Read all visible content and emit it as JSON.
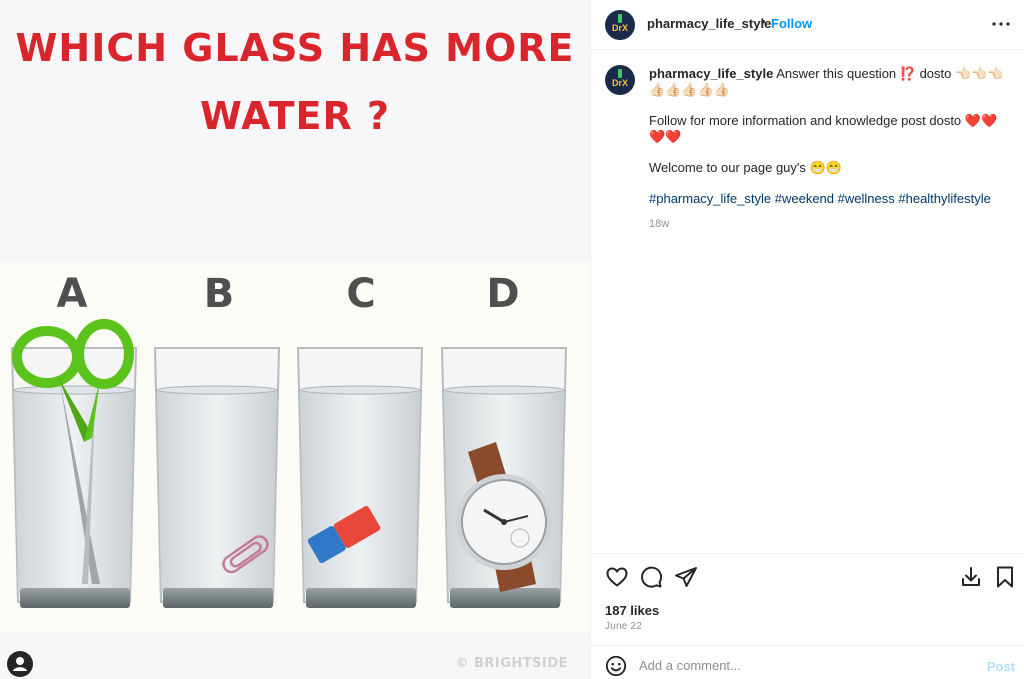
{
  "post_image": {
    "headline_line1": "WHICH GLASS HAS MORE",
    "headline_line2": "WATER ?",
    "glass_labels": [
      "A",
      "B",
      "C",
      "D"
    ],
    "watermark": "© BRIGHTSIDE",
    "colors": {
      "headline": "#d8262c",
      "label": "#4f4f4f",
      "scissors": "#5cc21c",
      "eraser_blue": "#2f79c8",
      "eraser_red": "#e8483c"
    }
  },
  "header": {
    "username": "pharmacy_life_style",
    "separator": "•",
    "follow_label": "Follow",
    "more_icon": "more-horizontal-icon",
    "avatar_monogram": "DrX"
  },
  "caption": {
    "username": "pharmacy_life_style",
    "line1": "Answer this question ⁉️ dosto 👈🏻👈🏻👈🏻👍🏻👍🏻👍🏻👍🏻👍🏻",
    "line2": "Follow for more information and knowledge post dosto ❤️❤️❤️❤️",
    "line3": "Welcome to our page guy's 😁😁",
    "hashtags": [
      "#pharmacy_life_style",
      "#weekend",
      "#wellness",
      "#healthylifestyle"
    ],
    "time_ago": "18w"
  },
  "actions": {
    "icons": [
      "heart-icon",
      "comment-icon",
      "share-icon",
      "save-to-collection-icon",
      "bookmark-icon"
    ],
    "likes": "187 likes",
    "date": "June 22"
  },
  "comment": {
    "placeholder": "Add a comment...",
    "post_label": "Post",
    "emoji_icon": "emoji-icon"
  },
  "colors": {
    "accent": "#0095f6",
    "hashtag": "#00376b",
    "muted": "#8e8e8e",
    "post_disabled": "#b2dffc"
  }
}
